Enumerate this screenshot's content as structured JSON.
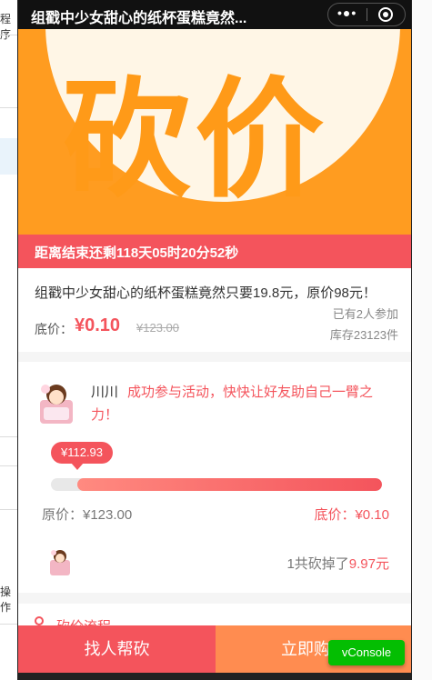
{
  "background": {
    "fragment_top": "程序",
    "fragment_bottom": "操作"
  },
  "navbar": {
    "title": "组戳中少女甜心的纸杯蛋糕竟然...",
    "more_icon": "more-dots-icon",
    "close_icon": "target-circle-icon"
  },
  "banner": {
    "logo_text": "砍价"
  },
  "countdown": {
    "text": "距离结束还剩118天05时20分52秒"
  },
  "product": {
    "description": "组戳中少女甜心的纸杯蛋糕竟然只要19.8元，原价98元！",
    "floor_label": "底价：",
    "floor_price": "¥0.10",
    "original_price": "¥123.00",
    "joined": "已有2人参加",
    "stock": "库存23123件"
  },
  "bargain": {
    "username": "川川",
    "message_line1": "成功参与活动，快快让好友助自己一臂之",
    "message_line2": "力！",
    "current_price": "¥112.93",
    "progress_fraction": 0.92,
    "original_label": "原价：¥123.00",
    "floor_label": "底价：¥0.10",
    "cut_prefix": "1共砍掉了",
    "cut_amount": "9.97元"
  },
  "process": {
    "label": "砍价流程"
  },
  "actions": {
    "help_label": "找人帮砍",
    "buy_label": "立即购",
    "vconsole_label": "vConsole"
  },
  "colors": {
    "accent": "#f4545c",
    "secondary": "#ff8c50",
    "banner": "#ff9c20",
    "vconsole": "#04be02"
  }
}
